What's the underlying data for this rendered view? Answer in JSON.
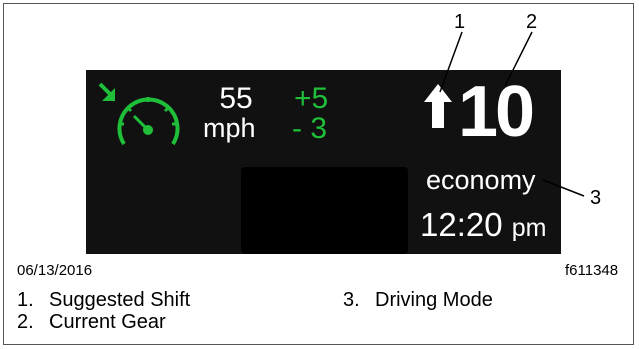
{
  "display": {
    "speed": "55",
    "speed_unit": "mph",
    "speed_plus": "+5",
    "speed_minus": "- 3",
    "current_gear": "10",
    "driving_mode": "economy",
    "time": "12:20",
    "time_period": "pm",
    "icons": {
      "cruise": "speedometer-cruise-icon",
      "shift": "upshift-arrow-icon"
    },
    "colors": {
      "background": "#111111",
      "accent_green": "#1fbf3a",
      "text": "#ffffff"
    }
  },
  "callouts": [
    "1",
    "2",
    "3"
  ],
  "date": "06/13/2016",
  "figure_id": "f611348",
  "legend": [
    {
      "num": "1.",
      "label": "Suggested Shift"
    },
    {
      "num": "2.",
      "label": "Current Gear"
    },
    {
      "num": "3.",
      "label": "Driving Mode"
    }
  ]
}
